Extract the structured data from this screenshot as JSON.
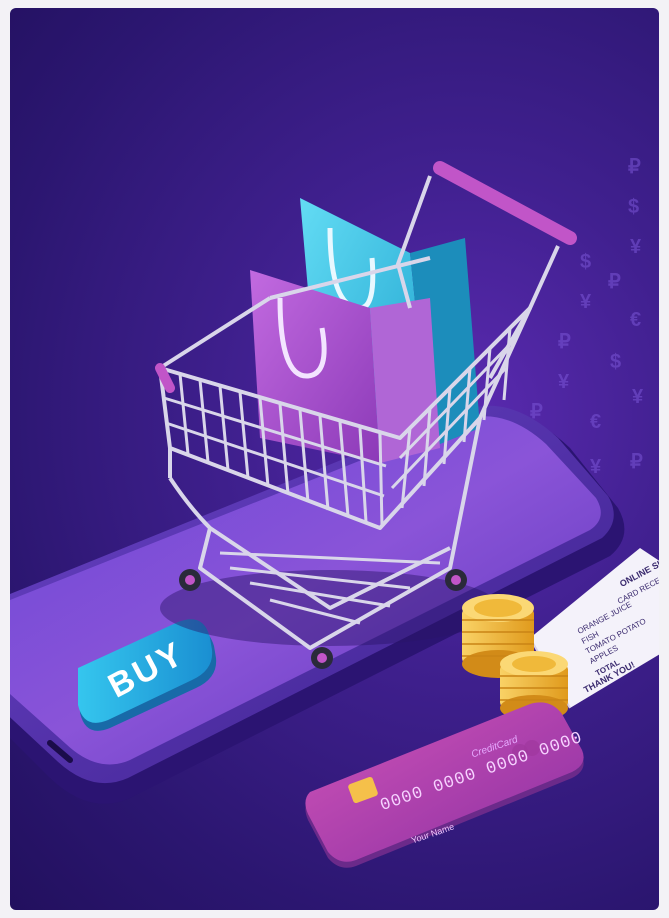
{
  "buy_button": {
    "label": "BUY"
  },
  "credit_card": {
    "brand": "CreditCard",
    "number": "0000 0000 0000 0000",
    "holder": "Your Name"
  },
  "receipt": {
    "title": "ONLINE SHOP",
    "subtitle": "CARD RECEIPT",
    "items": [
      "ORANGE JUICE",
      "FISH",
      "TOMATO POTATO",
      "APPLES"
    ],
    "total_label": "TOTAL",
    "thank_you": "THANK YOU!"
  },
  "colors": {
    "background": "#3a1c86",
    "bag_blue": "#3fc8ea",
    "bag_purple": "#b04fd0",
    "buy_button": "#2bb8e6",
    "card": "#c040b8",
    "coin": "#f4b630"
  }
}
